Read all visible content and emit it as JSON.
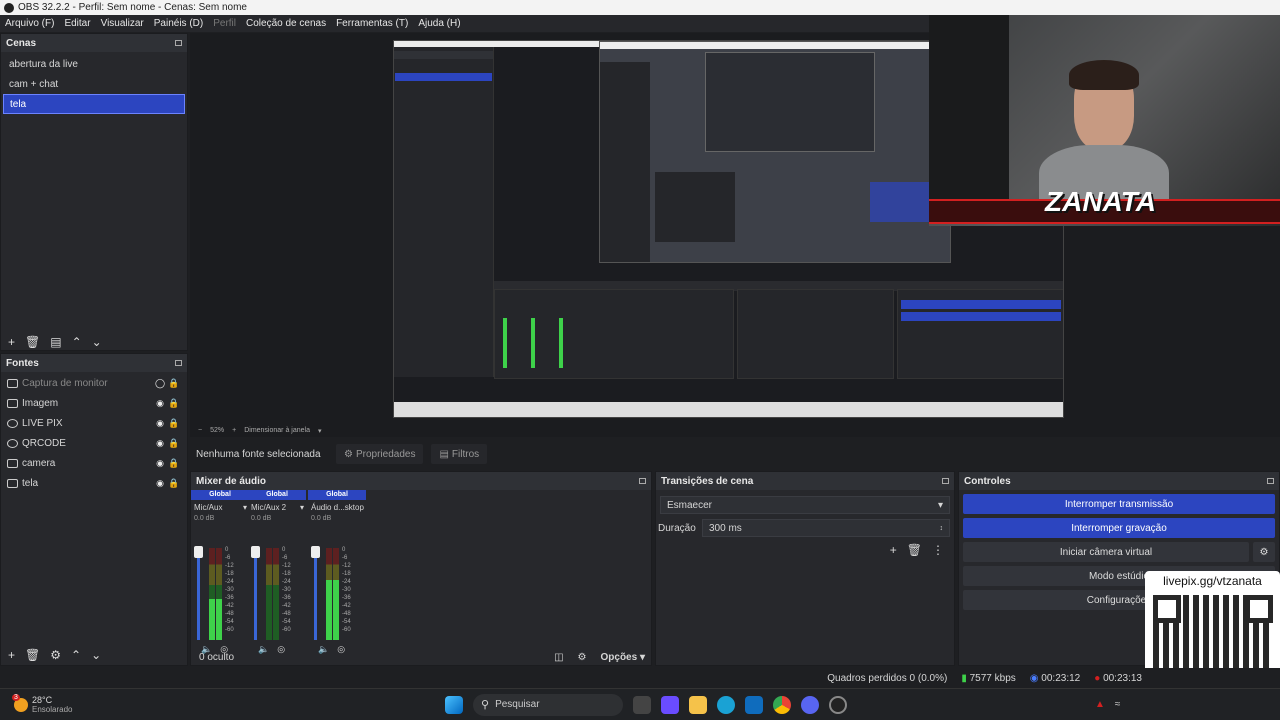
{
  "window": {
    "title": "OBS 32.2.2 - Perfil: Sem nome - Cenas: Sem nome"
  },
  "menu": {
    "items": [
      "Arquivo (F)",
      "Editar",
      "Visualizar",
      "Painéis (D)",
      "Perfil",
      "Coleção de cenas",
      "Ferramentas (T)",
      "Ajuda (H)"
    ]
  },
  "scenes": {
    "title": "Cenas",
    "items": [
      "abertura da live",
      "cam + chat",
      "tela"
    ],
    "selected": "tela"
  },
  "sources": {
    "title": "Fontes",
    "items": [
      {
        "label": "Captura de monitor",
        "icon": "monitor-icon",
        "visible": false
      },
      {
        "label": "Imagem",
        "icon": "image-icon",
        "visible": true
      },
      {
        "label": "LIVE PIX",
        "icon": "globe-icon",
        "visible": true
      },
      {
        "label": "QRCODE",
        "icon": "globe-icon",
        "visible": true
      },
      {
        "label": "camera",
        "icon": "camera-icon",
        "visible": true
      },
      {
        "label": "tela",
        "icon": "window-icon",
        "visible": true
      }
    ]
  },
  "preview": {
    "zoom": "52%",
    "scale_mode": "Dimensionar à janela"
  },
  "source_bar": {
    "no_source": "Nenhuma fonte selecionada",
    "properties": "Propriedades",
    "filters": "Filtros"
  },
  "mixer": {
    "title": "Mixer de áudio",
    "channels": [
      {
        "tag": "Global",
        "name": "Mic/Aux",
        "db": "0.0 dB",
        "level": 0.45
      },
      {
        "tag": "Global",
        "name": "Mic/Aux 2",
        "db": "0.0 dB",
        "level": 0.0
      },
      {
        "tag": "Global",
        "name": "Áudio d...sktop 2",
        "db": "0.0 dB",
        "level": 0.65
      }
    ],
    "scale": [
      "0",
      "-6",
      "-12",
      "-18",
      "-24",
      "-30",
      "-36",
      "-42",
      "-48",
      "-54",
      "-60"
    ],
    "hidden": "0 oculto",
    "options": "Opções"
  },
  "transitions": {
    "title": "Transições de cena",
    "effect": "Esmaecer",
    "duration_label": "Duração",
    "duration": "300 ms"
  },
  "controls": {
    "title": "Controles",
    "stop_stream": "Interromper transmissão",
    "stop_record": "Interromper gravação",
    "virtual_cam": "Iniciar câmera virtual",
    "studio_mode": "Modo estúdio",
    "settings": "Configurações"
  },
  "overlay": {
    "brand": "ZANATA",
    "livepix": "livepix.gg/vtzanata"
  },
  "status": {
    "dropped": "Quadros perdidos 0 (0.0%)",
    "bitrate": "7577 kbps",
    "stream_time": "00:23:12",
    "rec_time": "00:23:13"
  },
  "taskbar": {
    "weather_temp": "28°C",
    "weather_desc": "Ensolarado",
    "weather_badge": "3",
    "search": "Pesquisar"
  },
  "colors": {
    "accent": "#2c45c0",
    "panel": "#27282c",
    "meter_green": "#3ed24a",
    "record": "#d32020"
  }
}
